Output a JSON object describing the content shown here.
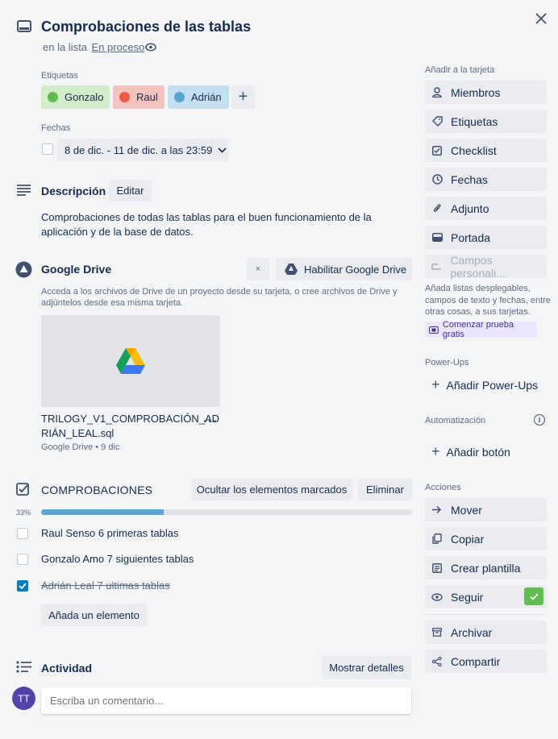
{
  "card": {
    "title": "Comprobaciones de las tablas",
    "list_prefix": "en la lista",
    "list_name": "En proceso"
  },
  "labels": {
    "heading": "Etiquetas",
    "items": [
      {
        "name": "Gonzalo",
        "color": "#61bd4f",
        "bg": "#d3ecca"
      },
      {
        "name": "Raul",
        "color": "#eb5a46",
        "bg": "#f5c3bd"
      },
      {
        "name": "Adrián",
        "color": "#5ba4cf",
        "bg": "#c3dff0"
      }
    ],
    "add_symbol": "+"
  },
  "dates": {
    "heading": "Fechas",
    "value": "8 de dic. - 11 de dic. a las 23:59"
  },
  "description": {
    "heading": "Descripción",
    "edit_label": "Editar",
    "text": "Comprobaciones de todas las tablas para el buen funcionamiento de la aplicación y de la base de datos."
  },
  "drive": {
    "heading": "Google Drive",
    "close_symbol": "×",
    "enable_label": "Habilitar Google Drive",
    "text": "Acceda a los archivos de Drive de un proyecto desde su tarjeta, o cree archivos de Drive y adjúntelos desde esa misma tarjeta.",
    "file_name_1": "TRILOGY_V1_COMPROBACIÓN_AD",
    "file_name_2": "RIÁN_LEAL.sql",
    "file_meta": "Google Drive • 9 dic",
    "more_symbol": "..."
  },
  "checklist": {
    "heading": "COMPROBACIONES",
    "hide_label": "Ocultar los elementos marcados",
    "delete_label": "Eliminar",
    "percent": "33%",
    "progress": 0.33,
    "items": [
      {
        "text": "Raul Senso 6 primeras tablas",
        "checked": false
      },
      {
        "text": "Gonzalo Amo 7 siguientes tablas",
        "checked": false
      },
      {
        "text": "Adrián Leal 7 ultimas tablas",
        "checked": true
      }
    ],
    "add_label": "Añada un elemento"
  },
  "activity": {
    "heading": "Actividad",
    "details_label": "Mostrar detalles",
    "avatar_initials": "TT",
    "comment_placeholder": "Escriba un comentario..."
  },
  "sidebar": {
    "add_heading": "Añadir a la tarjeta",
    "add_items": [
      {
        "label": "Miembros",
        "icon": "person-icon"
      },
      {
        "label": "Etiquetas",
        "icon": "tag-icon"
      },
      {
        "label": "Checklist",
        "icon": "checklist-icon"
      },
      {
        "label": "Fechas",
        "icon": "clock-icon"
      },
      {
        "label": "Adjunto",
        "icon": "paperclip-icon"
      },
      {
        "label": "Portada",
        "icon": "cover-icon"
      },
      {
        "label": "Campos personali...",
        "icon": "fields-icon"
      }
    ],
    "fields_promo": "Añada listas desplegables, campos de texto y fechas, entre otras cosas, a sus tarjetas.",
    "trial_label": "Comenzar prueba gratis",
    "powerups_heading": "Power-Ups",
    "add_powerups": "Añadir Power-Ups",
    "automation_heading": "Automatización",
    "add_button": "Añadir botón",
    "actions_heading": "Acciones",
    "actions": [
      {
        "label": "Mover",
        "icon": "arrow-right-icon"
      },
      {
        "label": "Copiar",
        "icon": "copy-icon"
      },
      {
        "label": "Crear plantilla",
        "icon": "template-icon"
      },
      {
        "label": "Seguir",
        "icon": "eye-icon"
      }
    ],
    "archive": "Archivar",
    "share": "Compartir"
  },
  "colors": {
    "checkbox_checked": "#0079bf",
    "progress_fill": "#5ba4cf",
    "follow_check": "#61bd4f",
    "avatar": "#5243aa",
    "trial_bg": "#eae6ff"
  }
}
